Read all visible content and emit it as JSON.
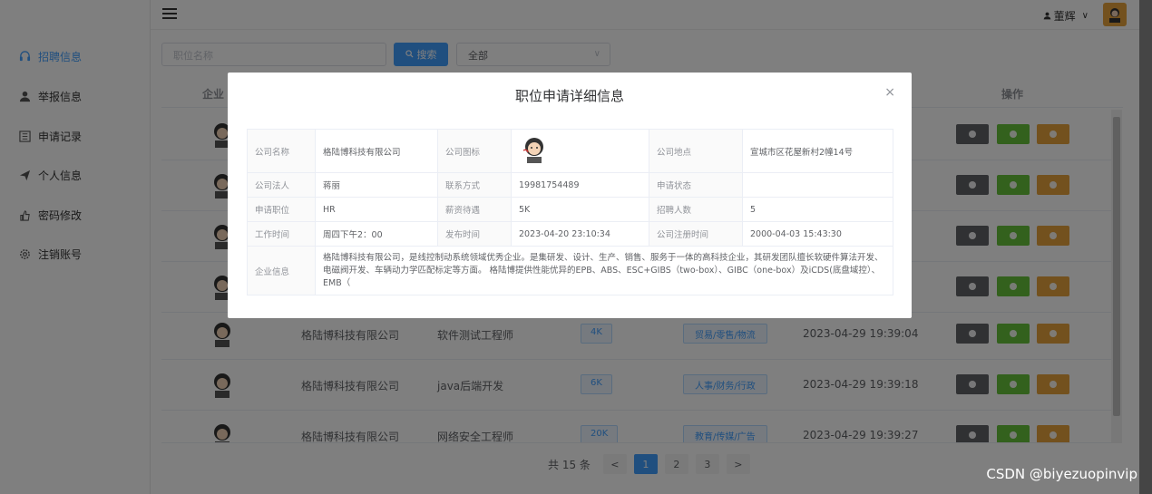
{
  "sidebar": {
    "items": [
      {
        "label": "招聘信息",
        "icon": "headset-icon",
        "active": true
      },
      {
        "label": "举报信息",
        "icon": "user-icon",
        "active": false
      },
      {
        "label": "申请记录",
        "icon": "list-icon",
        "active": false
      },
      {
        "label": "个人信息",
        "icon": "send-icon",
        "active": false
      },
      {
        "label": "密码修改",
        "icon": "thumb-icon",
        "active": false
      },
      {
        "label": "注销账号",
        "icon": "gear-icon",
        "active": false
      }
    ]
  },
  "header": {
    "user_name": "董辉",
    "user_caret": "∨"
  },
  "search": {
    "placeholder": "职位名称",
    "button_label": "搜索",
    "select_value": "全部"
  },
  "table": {
    "headers": {
      "company": "企业",
      "operation": "操作"
    },
    "rows": [
      {
        "company": "格陆博科技有限公司",
        "position": "软件测试工程师",
        "salary": "4K",
        "category": "贸易/零售/物流",
        "time": "2023-04-29 19:39:04"
      },
      {
        "company": "格陆博科技有限公司",
        "position": "java后端开发",
        "salary": "6K",
        "category": "人事/财务/行政",
        "time": "2023-04-29 19:39:18"
      },
      {
        "company": "格陆博科技有限公司",
        "position": "网络安全工程师",
        "salary": "20K",
        "category": "教育/传媒/广告",
        "time": "2023-04-29 19:39:27"
      }
    ]
  },
  "pagination": {
    "total": "共 15 条",
    "prev": "<",
    "next": ">",
    "pages": [
      "1",
      "2",
      "3"
    ],
    "current": "1"
  },
  "dialog": {
    "title": "职位申请详细信息",
    "close": "×",
    "labels": {
      "company_name": "公司名称",
      "company_logo": "公司图标",
      "company_location": "公司地点",
      "legal_person": "公司法人",
      "contact": "联系方式",
      "apply_status": "申请状态",
      "apply_position": "申请职位",
      "salary": "薪资待遇",
      "headcount": "招聘人数",
      "work_time": "工作时间",
      "publish_time": "发布时间",
      "register_time": "公司注册时间",
      "company_info": "企业信息"
    },
    "values": {
      "company_name": "格陆博科技有限公司",
      "company_location": "宣城市区花屋新村2幢14号",
      "legal_person": "蒋丽",
      "contact": "19981754489",
      "apply_status": "",
      "apply_position": "HR",
      "salary": "5K",
      "headcount": "5",
      "work_time": "周四下午2：00",
      "publish_time": "2023-04-20 23:10:34",
      "register_time": "2000-04-03 15:43:30",
      "company_info": "格陆博科技有限公司，是线控制动系统领域优秀企业。是集研发、设计、生产、销售、服务于一体的高科技企业，其研发团队擅长软硬件算法开发、电磁阀开发、车辆动力学匹配标定等方面。 格陆博提供性能优异的EPB、ABS、ESC+GIBS（two-box）、GIBC（one-box）及iCDS(底盘域控）、EMB（"
    }
  },
  "watermark": "CSDN @biyezuopinvip",
  "colors": {
    "accent": "#409eff",
    "success": "#67c23a",
    "warning": "#e6a23c",
    "dark": "#606266"
  }
}
